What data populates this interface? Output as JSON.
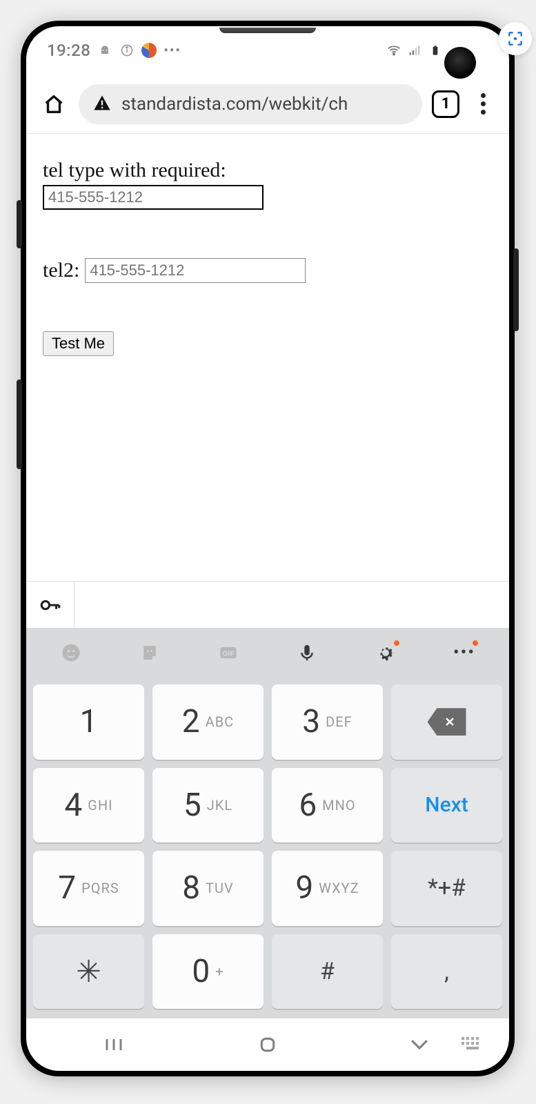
{
  "status": {
    "time": "19:28",
    "icons": {
      "android": "android-icon",
      "info": "info-icon",
      "browser": "firefox-icon",
      "more": "•••",
      "wifi": "wifi-icon",
      "signal": "signal-icon",
      "battery": "battery-icon"
    }
  },
  "browser": {
    "url": "standardista.com/webkit/ch",
    "tabs_count": "1"
  },
  "page": {
    "field1_label": "tel type with required:",
    "field1_placeholder": "415-555-1212",
    "field2_label": "tel2:",
    "field2_placeholder": "415-555-1212",
    "submit_label": "Test Me"
  },
  "keyboard": {
    "keys": [
      {
        "num": "1",
        "sub": ""
      },
      {
        "num": "2",
        "sub": "ABC"
      },
      {
        "num": "3",
        "sub": "DEF"
      },
      {
        "action": "backspace"
      },
      {
        "num": "4",
        "sub": "GHI"
      },
      {
        "num": "5",
        "sub": "JKL"
      },
      {
        "num": "6",
        "sub": "MNO"
      },
      {
        "action": "next",
        "label": "Next"
      },
      {
        "num": "7",
        "sub": "PQRS"
      },
      {
        "num": "8",
        "sub": "TUV"
      },
      {
        "num": "9",
        "sub": "WXYZ"
      },
      {
        "sym": "*+#"
      },
      {
        "sym": "✳"
      },
      {
        "num": "0",
        "sub": "+"
      },
      {
        "sym": "#"
      },
      {
        "sym": ","
      }
    ]
  }
}
